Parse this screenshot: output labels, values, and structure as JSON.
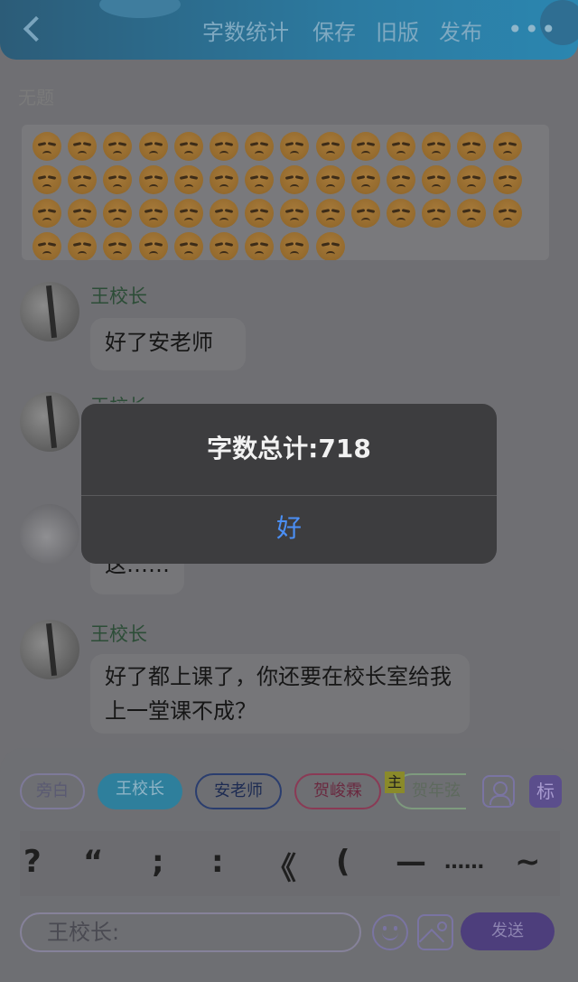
{
  "header": {
    "word_count": "字数统计",
    "save": "保存",
    "old_version": "旧版",
    "publish": "发布",
    "more": "•••"
  },
  "doc_title": "无题",
  "emoji_rows": [
    14,
    14,
    14,
    9
  ],
  "messages": [
    {
      "name": "王校长",
      "text": "好了安老师"
    },
    {
      "name": "王校长",
      "text": ""
    },
    {
      "name": "",
      "text": "这……"
    },
    {
      "name": "王校长",
      "text": "好了都上课了，你还要在校长室给我上一堂课不成？"
    }
  ],
  "roles": {
    "narration": "旁白",
    "principal_wang": "王校长",
    "teacher_an": "安老师",
    "he_junlin": "贺峻霖",
    "main_badge": "主",
    "he_nianxian": "贺年弦",
    "tag": "标"
  },
  "punctuation": [
    "?",
    "“",
    ";",
    ":",
    "《",
    "(",
    "—",
    "……",
    "~"
  ],
  "composer": {
    "placeholder": "王校长:",
    "send": "发送"
  },
  "dialog": {
    "message": "字数总计:718",
    "ok": "好"
  },
  "colors": {
    "accent_blue": "#4b8ff5",
    "principal_role": "#2e7f9c",
    "send_button": "#4d3e7c"
  }
}
